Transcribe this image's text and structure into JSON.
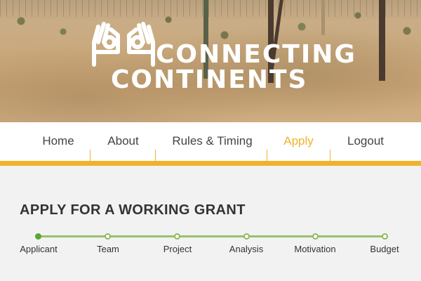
{
  "brand": {
    "line1": "CONNECTING",
    "line2": "CONTINENTS"
  },
  "nav": {
    "items": [
      {
        "label": "Home",
        "active": false
      },
      {
        "label": "About",
        "active": false
      },
      {
        "label": "Rules & Timing",
        "active": false
      },
      {
        "label": "Apply",
        "active": true
      },
      {
        "label": "Logout",
        "active": false
      }
    ],
    "accent_color": "#f0b22e"
  },
  "main": {
    "title": "APPLY FOR A WORKING GRANT",
    "steps": [
      {
        "label": "Applicant",
        "state": "current"
      },
      {
        "label": "Team",
        "state": "pending"
      },
      {
        "label": "Project",
        "state": "pending"
      },
      {
        "label": "Analysis",
        "state": "pending"
      },
      {
        "label": "Motivation",
        "state": "pending"
      },
      {
        "label": "Budget",
        "state": "pending"
      }
    ],
    "progress_color": "#8dbb5c"
  }
}
